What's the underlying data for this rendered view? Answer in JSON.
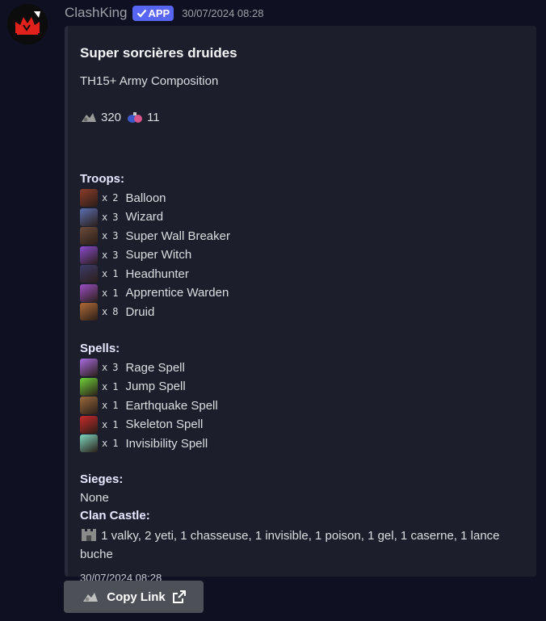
{
  "message": {
    "author": "ClashKing",
    "badge": "APP",
    "timestamp": "30/07/2024 08:28"
  },
  "embed": {
    "title": "Super sorcières druides",
    "subtitle": "TH15+ Army Composition",
    "stats": {
      "housing": "320",
      "spell_housing": "11"
    },
    "troops_heading": "Troops:",
    "troops": [
      {
        "qty": "2",
        "name": "Balloon",
        "icon": "balloon-icon",
        "color": "#8c3b2a"
      },
      {
        "qty": "3",
        "name": "Wizard",
        "icon": "wizard-icon",
        "color": "#5b6fb0"
      },
      {
        "qty": "3",
        "name": "Super Wall Breaker",
        "icon": "super-wall-breaker-icon",
        "color": "#6a4a3a"
      },
      {
        "qty": "3",
        "name": "Super Witch",
        "icon": "super-witch-icon",
        "color": "#8a4bd0"
      },
      {
        "qty": "1",
        "name": "Headhunter",
        "icon": "headhunter-icon",
        "color": "#3d3b6a"
      },
      {
        "qty": "1",
        "name": "Apprentice Warden",
        "icon": "apprentice-warden-icon",
        "color": "#9b4fc4"
      },
      {
        "qty": "8",
        "name": "Druid",
        "icon": "druid-icon",
        "color": "#b06a38"
      }
    ],
    "spells_heading": "Spells:",
    "spells": [
      {
        "qty": "3",
        "name": "Rage Spell",
        "icon": "rage-spell-icon",
        "color": "#a86be0"
      },
      {
        "qty": "1",
        "name": "Jump Spell",
        "icon": "jump-spell-icon",
        "color": "#6fd13a"
      },
      {
        "qty": "1",
        "name": "Earthquake Spell",
        "icon": "earthquake-spell-icon",
        "color": "#9a6a3c"
      },
      {
        "qty": "1",
        "name": "Skeleton Spell",
        "icon": "skeleton-spell-icon",
        "color": "#c82a2a"
      },
      {
        "qty": "1",
        "name": "Invisibility Spell",
        "icon": "invisibility-spell-icon",
        "color": "#7fd8c0"
      }
    ],
    "sieges_heading": "Sieges:",
    "sieges_value": "None",
    "clan_castle_heading": "Clan Castle:",
    "clan_castle_value": "1 valky, 2 yeti, 1 chasseuse, 1 invisible, 1 poison, 1 gel, 1 caserne, 1 lance buche",
    "footer_timestamp": "30/07/2024 08:28"
  },
  "copy_button": {
    "label": "Copy Link"
  }
}
